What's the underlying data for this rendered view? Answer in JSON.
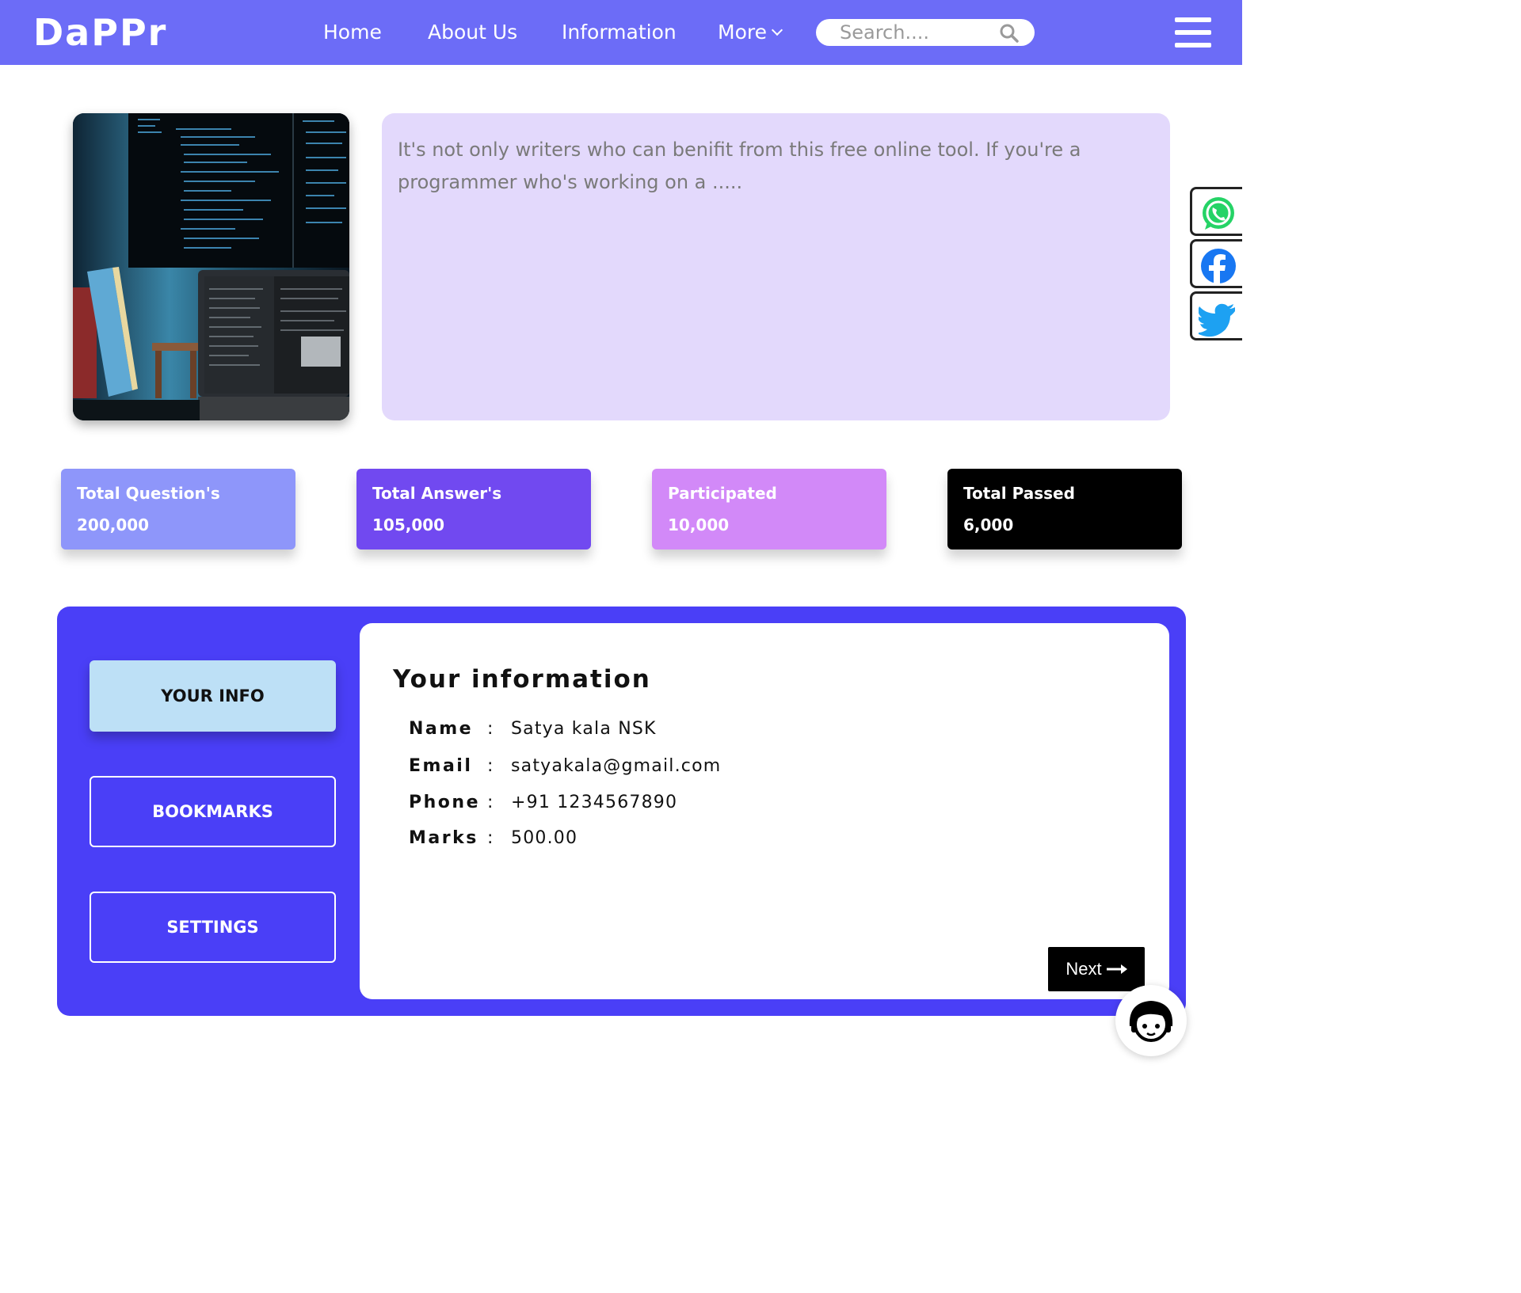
{
  "brand": {
    "logo": "DaPPr"
  },
  "nav": {
    "links": [
      "Home",
      "About Us",
      "Information",
      "More"
    ],
    "search_placeholder": "Search...."
  },
  "hero": {
    "text": "It's not only writers who can benifit from this free online tool. If you're a programmer who's working on a ....."
  },
  "social": [
    "whatsapp-icon",
    "facebook-icon",
    "twitter-icon"
  ],
  "stats": [
    {
      "label": "Total Question's",
      "value": "200,000",
      "color": "#8e96fa"
    },
    {
      "label": "Total Answer's",
      "value": "105,000",
      "color": "#7149f0"
    },
    {
      "label": "Participated",
      "value": "10,000",
      "color": "#d289f8"
    },
    {
      "label": "Total Passed",
      "value": "6,000",
      "color": "#000000"
    }
  ],
  "sidebar": {
    "items": [
      "YOUR INFO",
      "BOOKMARKS",
      "SETTINGS"
    ],
    "active": "YOUR INFO"
  },
  "profile": {
    "title": "Your information",
    "rows": [
      {
        "label": "Name",
        "value": "Satya kala NSK"
      },
      {
        "label": "Email",
        "value": "satyakala@gmail.com"
      },
      {
        "label": "Phone",
        "value": "+91 1234567890"
      },
      {
        "label": "Marks",
        "value": "500.00"
      }
    ],
    "next_label": "Next"
  },
  "colors": {
    "navbar": "#6c6cf7",
    "hero_card": "#e3d9fc",
    "panel": "#4a3ff7",
    "active_tab": "#bde0f6"
  }
}
